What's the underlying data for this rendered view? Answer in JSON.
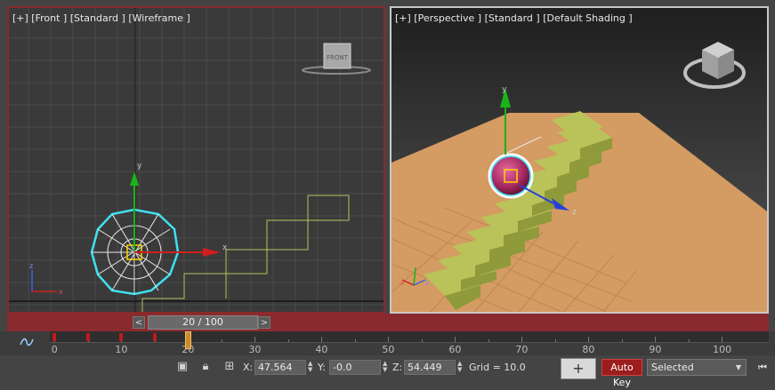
{
  "viewports": {
    "front": {
      "label": "[+] [Front ] [Standard ] [Wireframe ]",
      "viewcube_face": "FRONT"
    },
    "perspective": {
      "label": "[+] [Perspective ] [Standard ] [Default Shading ]"
    }
  },
  "gizmo_axes": {
    "x": "x",
    "y": "y",
    "z": "z"
  },
  "time_slider": {
    "value": "20 / 100",
    "prev_label": "<",
    "next_label": ">",
    "current_frame": 20,
    "total_frames": 100
  },
  "trackbar": {
    "tick_labels": [
      "0",
      "10",
      "20",
      "30",
      "40",
      "50",
      "60",
      "70",
      "80",
      "90",
      "100"
    ],
    "key_frames": [
      0,
      5,
      10,
      15
    ]
  },
  "status": {
    "x_label": "X:",
    "x_value": "47.564",
    "y_label": "Y:",
    "y_value": "-0.0",
    "z_label": "Z:",
    "z_value": "54.449",
    "grid": "Grid = 10.0",
    "autokey_label": "Auto Key",
    "key_mode_icon": "+",
    "selection_filter": "Selected"
  },
  "icons": {
    "curve_editor": "curve-editor-icon",
    "isolate": "isolate-selection-icon",
    "lock": "lock-icon",
    "absolute_mode": "absolute-mode-icon",
    "goto_start": "go-to-start-icon"
  },
  "colors": {
    "active_viewport_border": "#8a2a2a",
    "timebar": "#8b2a2e",
    "autokey": "#9b1d1d",
    "stairs_wire": "#b8c25a",
    "stairs_shaded": "#b9c35a",
    "ground": "#d49b62",
    "sphere": "#b13a72",
    "selection": "#40e0f0"
  }
}
